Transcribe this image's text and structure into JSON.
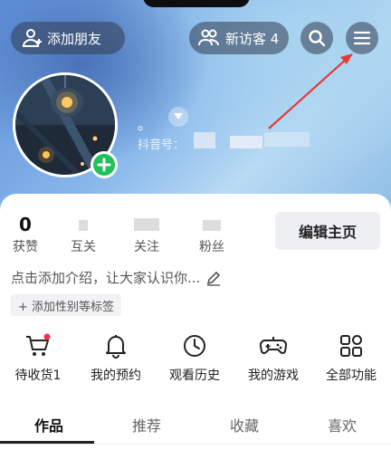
{
  "top_bar": {
    "add_friend_label": "添加朋友",
    "visitors_label": "新访客 4",
    "search_icon": "search-icon",
    "menu_icon": "hamburger-menu-icon"
  },
  "profile": {
    "name": "。",
    "id_label": "抖音号："
  },
  "stats": [
    {
      "value": "0",
      "label": "获赞"
    },
    {
      "value": "",
      "label": "互关"
    },
    {
      "value": "",
      "label": "关注"
    },
    {
      "value": "",
      "label": "粉丝"
    }
  ],
  "edit_profile_label": "编辑主页",
  "bio_placeholder": "点击添加介绍，让大家认识你...",
  "tag_label": "+ 添加性别等标签",
  "functions": [
    {
      "label": "待收货1",
      "icon": "cart-icon"
    },
    {
      "label": "我的预约",
      "icon": "bell-icon"
    },
    {
      "label": "观看历史",
      "icon": "clock-icon"
    },
    {
      "label": "我的游戏",
      "icon": "gamepad-icon"
    },
    {
      "label": "全部功能",
      "icon": "grid-icon"
    }
  ],
  "tabs": [
    "作品",
    "推荐",
    "收藏",
    "喜欢"
  ],
  "colors": {
    "accent_green": "#20c05a",
    "annotation_red": "#e53935",
    "badge_red": "#fe2c55"
  }
}
